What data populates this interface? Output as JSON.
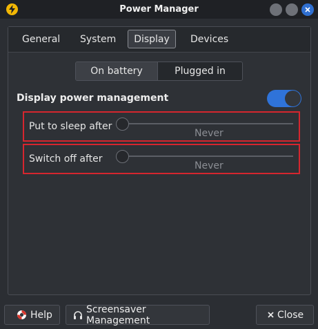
{
  "window": {
    "title": "Power Manager"
  },
  "tabs": [
    {
      "label": "General",
      "active": false
    },
    {
      "label": "System",
      "active": false
    },
    {
      "label": "Display",
      "active": true
    },
    {
      "label": "Devices",
      "active": false
    }
  ],
  "power_source": {
    "options": [
      "On battery",
      "Plugged in"
    ],
    "selected": "On battery"
  },
  "display_power_management": {
    "label": "Display power management",
    "enabled": true
  },
  "sliders": [
    {
      "label": "Put to sleep after",
      "value": "Never",
      "level": 0
    },
    {
      "label": "Switch off after",
      "value": "Never",
      "level": 0
    }
  ],
  "buttons": {
    "help": "Help",
    "screensaver": "Screensaver Management",
    "close": "Close"
  },
  "colors": {
    "accent": "#2f73d9",
    "highlight_border": "#d6262e",
    "app_icon": "#f2b705"
  },
  "icons": {
    "app": "lightning-icon",
    "help": "lifebuoy-icon",
    "screensaver": "headphones-icon",
    "close": "x-icon"
  }
}
